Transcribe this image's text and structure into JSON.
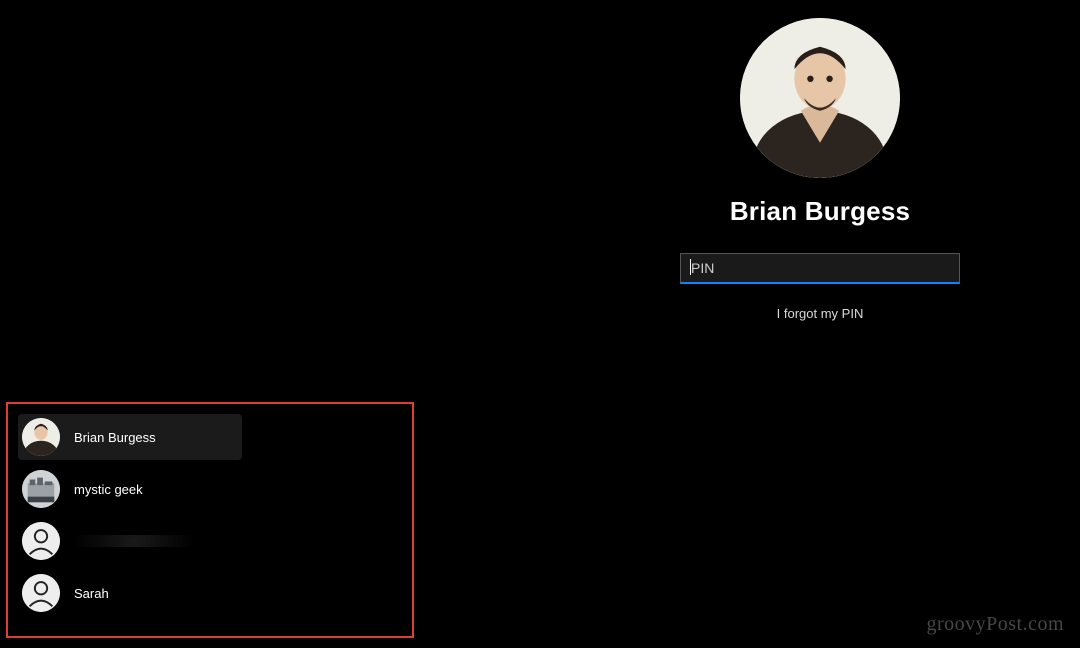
{
  "login": {
    "display_name": "Brian Burgess",
    "pin_placeholder": "PIN",
    "pin_value": "",
    "forgot_label": "I forgot my PIN"
  },
  "accent_color": "#0a84ff",
  "annotation_border_color": "#e03b3b",
  "user_switcher": {
    "users": [
      {
        "label": "Brian Burgess",
        "avatar": "photo-brian",
        "selected": true
      },
      {
        "label": "mystic geek",
        "avatar": "photo-mystic",
        "selected": false
      },
      {
        "label": "",
        "avatar": "generic",
        "selected": false,
        "redacted": true
      },
      {
        "label": "Sarah",
        "avatar": "generic",
        "selected": false
      }
    ]
  },
  "watermark": "groovyPost.com"
}
